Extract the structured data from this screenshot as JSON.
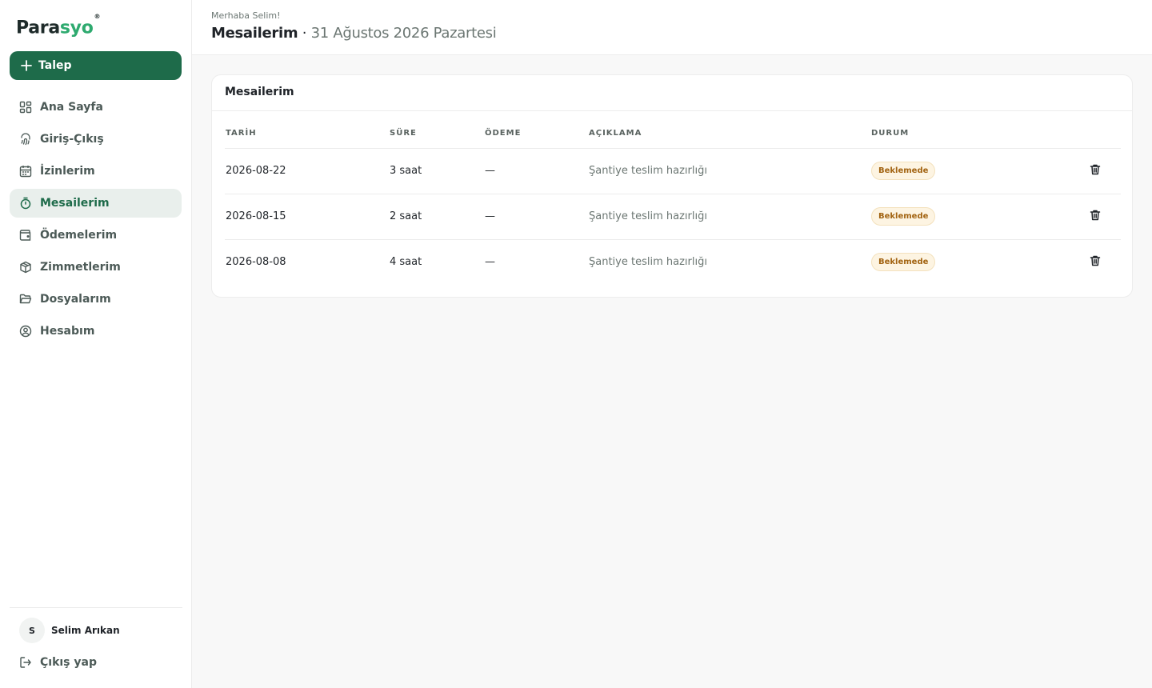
{
  "brand": {
    "part1": "Para",
    "part2": "syo",
    "reg": "®"
  },
  "sidebar": {
    "cta_label": "Talep",
    "items": [
      {
        "label": "Ana Sayfa",
        "icon": "dashboard-icon"
      },
      {
        "label": "Giriş-Çıkış",
        "icon": "fingerprint-icon"
      },
      {
        "label": "İzinlerim",
        "icon": "calendar-icon"
      },
      {
        "label": "Mesailerim",
        "icon": "stopwatch-icon",
        "active": true
      },
      {
        "label": "Ödemelerim",
        "icon": "wallet-icon"
      },
      {
        "label": "Zimmetlerim",
        "icon": "package-icon"
      },
      {
        "label": "Dosyalarım",
        "icon": "folder-icon"
      },
      {
        "label": "Hesabım",
        "icon": "user-circle-icon"
      }
    ],
    "user": {
      "initial": "S",
      "name": "Selim Arıkan"
    },
    "logout_label": "Çıkış yap"
  },
  "header": {
    "greeting": "Merhaba Selim!",
    "title": "Mesailerim",
    "separator": " · ",
    "date": "31 Ağustos 2026 Pazartesi"
  },
  "card": {
    "title": "Mesailerim",
    "columns": [
      "TARİH",
      "SÜRE",
      "ÖDEME",
      "AÇIKLAMA",
      "DURUM"
    ],
    "rows": [
      {
        "date": "2026-08-22",
        "duration": "3 saat",
        "payment": "—",
        "description": "Şantiye teslim hazırlığı",
        "status": "Beklemede"
      },
      {
        "date": "2026-08-15",
        "duration": "2 saat",
        "payment": "—",
        "description": "Şantiye teslim hazırlığı",
        "status": "Beklemede"
      },
      {
        "date": "2026-08-08",
        "duration": "4 saat",
        "payment": "—",
        "description": "Şantiye teslim hazırlığı",
        "status": "Beklemede"
      }
    ]
  },
  "colors": {
    "primary": "#1e6b4a",
    "brand_green": "#2eaa6f",
    "active_bg": "#e9efec",
    "badge_text": "#a26311",
    "badge_bg": "#fdf4e2"
  }
}
